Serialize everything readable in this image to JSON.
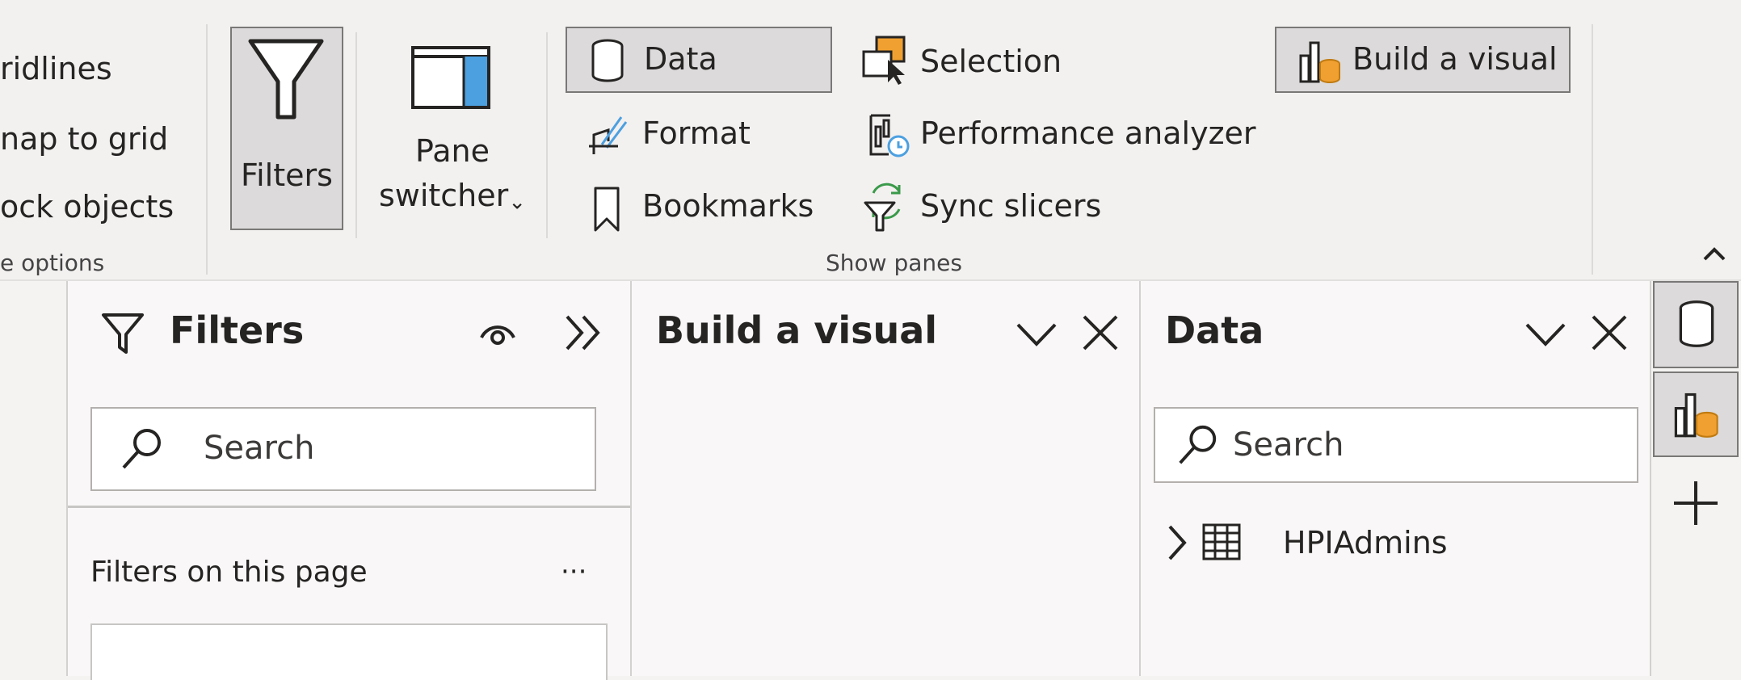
{
  "ribbon": {
    "page_options": {
      "items": [
        "ridlines",
        "nap to grid",
        "ock objects"
      ],
      "group_label": "e options"
    },
    "filters_button": {
      "label": "Filters"
    },
    "pane_switcher": {
      "line1": "Pane",
      "line2": "switcher"
    },
    "show_panes": {
      "group_label": "Show panes",
      "data": "Data",
      "format": "Format",
      "bookmarks": "Bookmarks",
      "selection": "Selection",
      "performance": "Performance analyzer",
      "sync": "Sync slicers",
      "build": "Build a visual"
    }
  },
  "filters_pane": {
    "title": "Filters",
    "search_placeholder": "Search",
    "section": "Filters on this page",
    "more": "···"
  },
  "build_pane": {
    "title": "Build a visual"
  },
  "data_pane": {
    "title": "Data",
    "search_placeholder": "Search",
    "tables": [
      "HPIAdmins"
    ]
  },
  "colors": {
    "accent_blue": "#4ca0e0",
    "accent_orange": "#f0a030",
    "sync_green": "#3a9a4a"
  }
}
